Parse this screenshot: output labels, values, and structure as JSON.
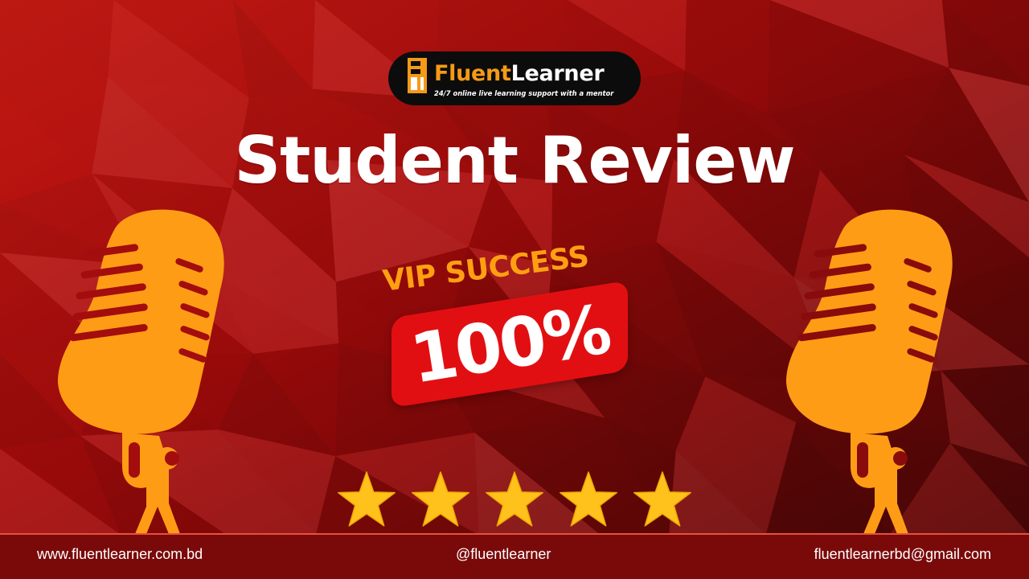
{
  "brand": {
    "name_part1": "Fluent",
    "name_part2": "Learner",
    "tagline": "24/7 online live learning support with a mentor"
  },
  "headline": "Student Review",
  "badge": {
    "label": "VIP SUCCESS",
    "value": "100%"
  },
  "rating": {
    "stars": 5,
    "max": 5
  },
  "footer": {
    "website": "www.fluentlearner.com.bd",
    "handle": "@fluentlearner",
    "email": "fluentlearnerbd@gmail.com"
  },
  "colors": {
    "background": "#a30d0d",
    "accent_orange": "#f59a17",
    "badge_red": "#e20f12",
    "star_yellow": "#ffc21c",
    "pill_black": "#0c0c0c",
    "text_white": "#ffffff"
  }
}
